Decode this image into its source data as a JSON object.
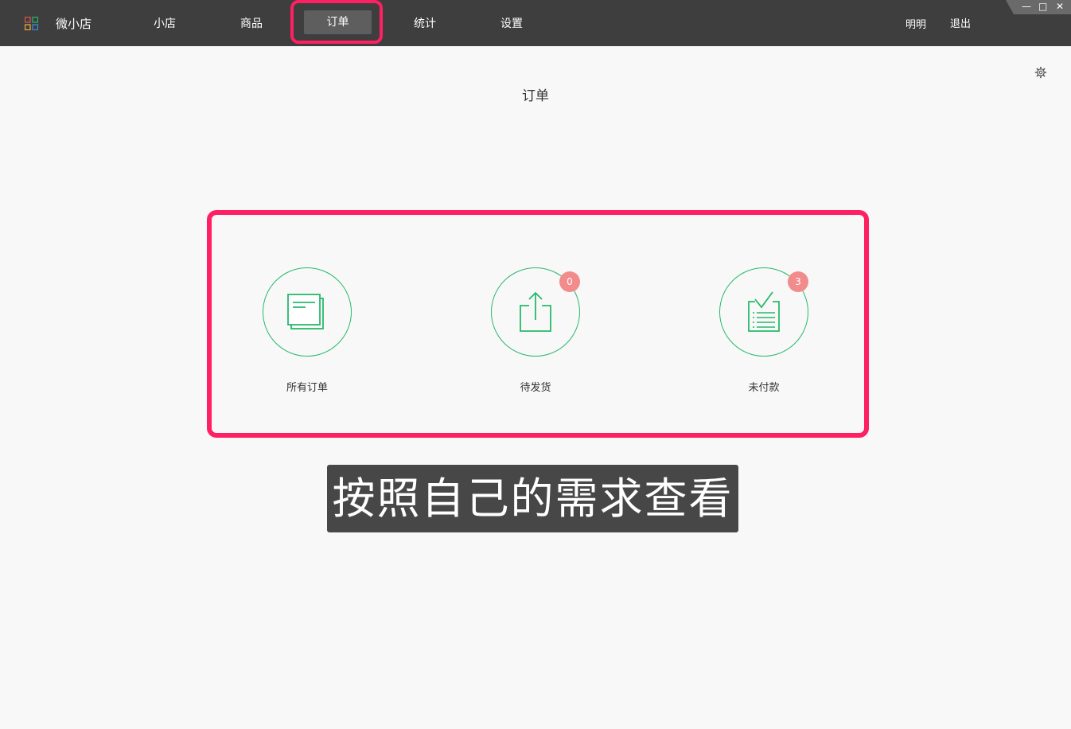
{
  "app": {
    "name": "微小店"
  },
  "nav": {
    "items": [
      {
        "label": "小店"
      },
      {
        "label": "商品"
      },
      {
        "label": "订单"
      },
      {
        "label": "统计"
      },
      {
        "label": "设置"
      }
    ],
    "active": "订单"
  },
  "user": {
    "name": "明明",
    "logout_label": "退出"
  },
  "window_controls": {
    "minimize": "—",
    "maximize": "□",
    "close": "✕"
  },
  "page": {
    "title": "订单"
  },
  "order_cards": [
    {
      "label": "所有订单",
      "icon": "documents-icon"
    },
    {
      "label": "待发货",
      "icon": "share-upload-icon",
      "badge": "0"
    },
    {
      "label": "未付款",
      "icon": "checklist-icon",
      "badge": "3"
    }
  ],
  "caption": {
    "text": "按照自己的需求查看"
  },
  "colors": {
    "accent": "#27b96b",
    "highlight": "#ff1f63",
    "badge": "#f28b8b",
    "topbar": "#3e3e3e"
  }
}
